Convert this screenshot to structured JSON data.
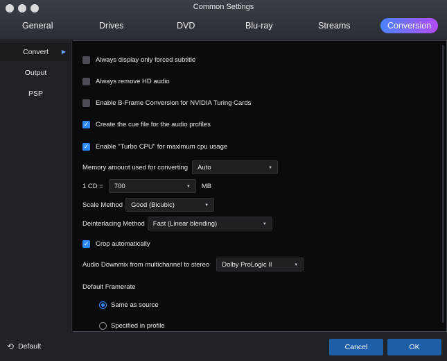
{
  "window": {
    "title": "Common Settings"
  },
  "tabs": [
    {
      "label": "General"
    },
    {
      "label": "Drives"
    },
    {
      "label": "DVD"
    },
    {
      "label": "Blu-ray"
    },
    {
      "label": "Streams"
    },
    {
      "label": "Conversion",
      "active": true
    }
  ],
  "sidebar": {
    "items": [
      {
        "label": "Convert",
        "active": true
      },
      {
        "label": "Output"
      },
      {
        "label": "PSP"
      }
    ]
  },
  "options": {
    "forced_subtitle": {
      "label": "Always display only forced subtitle",
      "checked": false
    },
    "remove_hd_audio": {
      "label": "Always remove HD audio",
      "checked": false
    },
    "bframe_nvidia": {
      "label": "Enable B-Frame Conversion for NVIDIA Turing Cards",
      "checked": false
    },
    "cue_file": {
      "label": "Create the cue file for the audio profiles",
      "checked": true
    },
    "turbo_cpu": {
      "label": "Enable \"Turbo CPU\" for maximum cpu usage",
      "checked": true
    },
    "memory": {
      "label": "Memory amount used for converting",
      "value": "Auto"
    },
    "cd_size": {
      "label": "1 CD =",
      "value": "700",
      "unit": "MB"
    },
    "scale_method": {
      "label": "Scale Method",
      "value": "Good (Bicubic)"
    },
    "deinterlacing": {
      "label": "Deinterlacing Method",
      "value": "Fast (Linear blending)"
    },
    "crop": {
      "label": "Crop automatically",
      "checked": true
    },
    "downmix": {
      "label": "Audio Downmix from multichannel to stereo",
      "value": "Dolby ProLogic II"
    },
    "framerate": {
      "label": "Default Framerate",
      "same_as_source": "Same as source",
      "specified": "Specified in profile"
    }
  },
  "footer": {
    "default_label": "Default",
    "cancel_label": "Cancel",
    "ok_label": "OK"
  },
  "colors": {
    "accent": "#2f88ff",
    "button": "#1d5ea8",
    "tab_gradient_start": "#4a84ff",
    "tab_gradient_end": "#b24bf5"
  }
}
